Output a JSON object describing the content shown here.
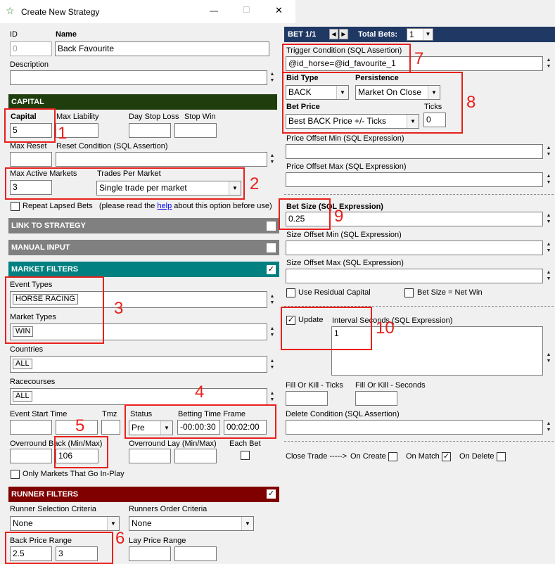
{
  "window": {
    "title": "Create New Strategy",
    "minimize": "—",
    "maximize": "☐",
    "close": "✕"
  },
  "general": {
    "id_label": "ID",
    "id_value": "0",
    "name_label": "Name",
    "name_value": "Back Favourite",
    "description_label": "Description",
    "description_value": ""
  },
  "capital": {
    "header": "CAPITAL",
    "capital_label": "Capital",
    "capital_value": "5",
    "max_liability_label": "Max Liability",
    "max_liability_value": "",
    "day_stop_loss_label": "Day Stop Loss",
    "day_stop_loss_value": "",
    "stop_win_label": "Stop Win",
    "stop_win_value": "",
    "max_reset_label": "Max Reset",
    "max_reset_value": "",
    "reset_condition_label": "Reset Condition (SQL Assertion)",
    "reset_condition_value": "",
    "max_active_markets_label": "Max Active Markets",
    "max_active_markets_value": "3",
    "trades_per_market_label": "Trades Per Market",
    "trades_per_market_value": "Single trade per market",
    "repeat_lapsed_label": "Repeat Lapsed Bets",
    "repeat_lapsed_note_pre": "(please read the",
    "repeat_lapsed_help": "help",
    "repeat_lapsed_note_post": "about this option before use)"
  },
  "link_to_strategy": {
    "header": "LINK TO STRATEGY"
  },
  "manual_input": {
    "header": "MANUAL INPUT"
  },
  "market_filters": {
    "header": "MARKET FILTERS",
    "event_types_label": "Event Types",
    "event_types_value": "HORSE RACING",
    "market_types_label": "Market Types",
    "market_types_value": "WIN",
    "countries_label": "Countries",
    "countries_value": "ALL",
    "racecourses_label": "Racecourses",
    "racecourses_value": "ALL",
    "event_start_time_label": "Event Start Time",
    "tmz_label": "Tmz",
    "status_label": "Status",
    "status_value": "Pre",
    "betting_time_frame_label": "Betting Time Frame",
    "betting_time_from": "-00:00:30",
    "betting_time_to": "00:02:00",
    "overround_back_label": "Overround Back (Min/Max)",
    "overround_back_max": "106",
    "overround_lay_label": "Overround Lay (Min/Max)",
    "each_bet_label": "Each Bet",
    "only_inplay_label": "Only Markets That Go In-Play"
  },
  "runner_filters": {
    "header": "RUNNER FILTERS",
    "selection_criteria_label": "Runner Selection Criteria",
    "selection_criteria_value": "None",
    "order_criteria_label": "Runners Order Criteria",
    "order_criteria_value": "None",
    "back_price_range_label": "Back Price Range",
    "back_price_min": "2.5",
    "back_price_max": "3",
    "lay_price_range_label": "Lay Price Range"
  },
  "bet": {
    "header": "BET 1/1",
    "total_bets_label": "Total Bets:",
    "total_bets_value": "1",
    "trigger_label": "Trigger Condition (SQL Assertion)",
    "trigger_value": "@id_horse=@id_favourite_1",
    "bid_type_label": "Bid Type",
    "bid_type_value": "BACK",
    "persistence_label": "Persistence",
    "persistence_value": "Market On Close",
    "bet_price_label": "Bet Price",
    "bet_price_value": "Best BACK Price +/- Ticks",
    "ticks_label": "Ticks",
    "ticks_value": "0",
    "price_offset_min_label": "Price Offset Min (SQL Expression)",
    "price_offset_max_label": "Price Offset Max (SQL Expression)",
    "bet_size_label": "Bet Size (SQL Expression)",
    "bet_size_value": "0.25",
    "size_offset_min_label": "Size Offset Min (SQL Expression)",
    "size_offset_max_label": "Size Offset Max (SQL Expression)",
    "use_residual_label": "Use Residual Capital",
    "bet_size_net_win_label": "Bet Size = Net Win",
    "update_label": "Update",
    "interval_label": "Interval Seconds (SQL Expression)",
    "interval_value": "1",
    "fok_ticks_label": "Fill Or Kill - Ticks",
    "fok_seconds_label": "Fill Or Kill - Seconds",
    "delete_condition_label": "Delete Condition (SQL Assertion)",
    "close_trade_label": "Close Trade ----->",
    "on_create_label": "On Create",
    "on_match_label": "On Match",
    "on_delete_label": "On Delete"
  },
  "annotations": [
    "1",
    "2",
    "3",
    "4",
    "5",
    "6",
    "7",
    "8",
    "9",
    "10"
  ],
  "colors": {
    "capital": "#1f3d0d",
    "gray_band": "#808080",
    "market_filters": "#008080",
    "runner_filters": "#800000",
    "bet_header": "#1f3864",
    "annotation": "#e8201b"
  }
}
